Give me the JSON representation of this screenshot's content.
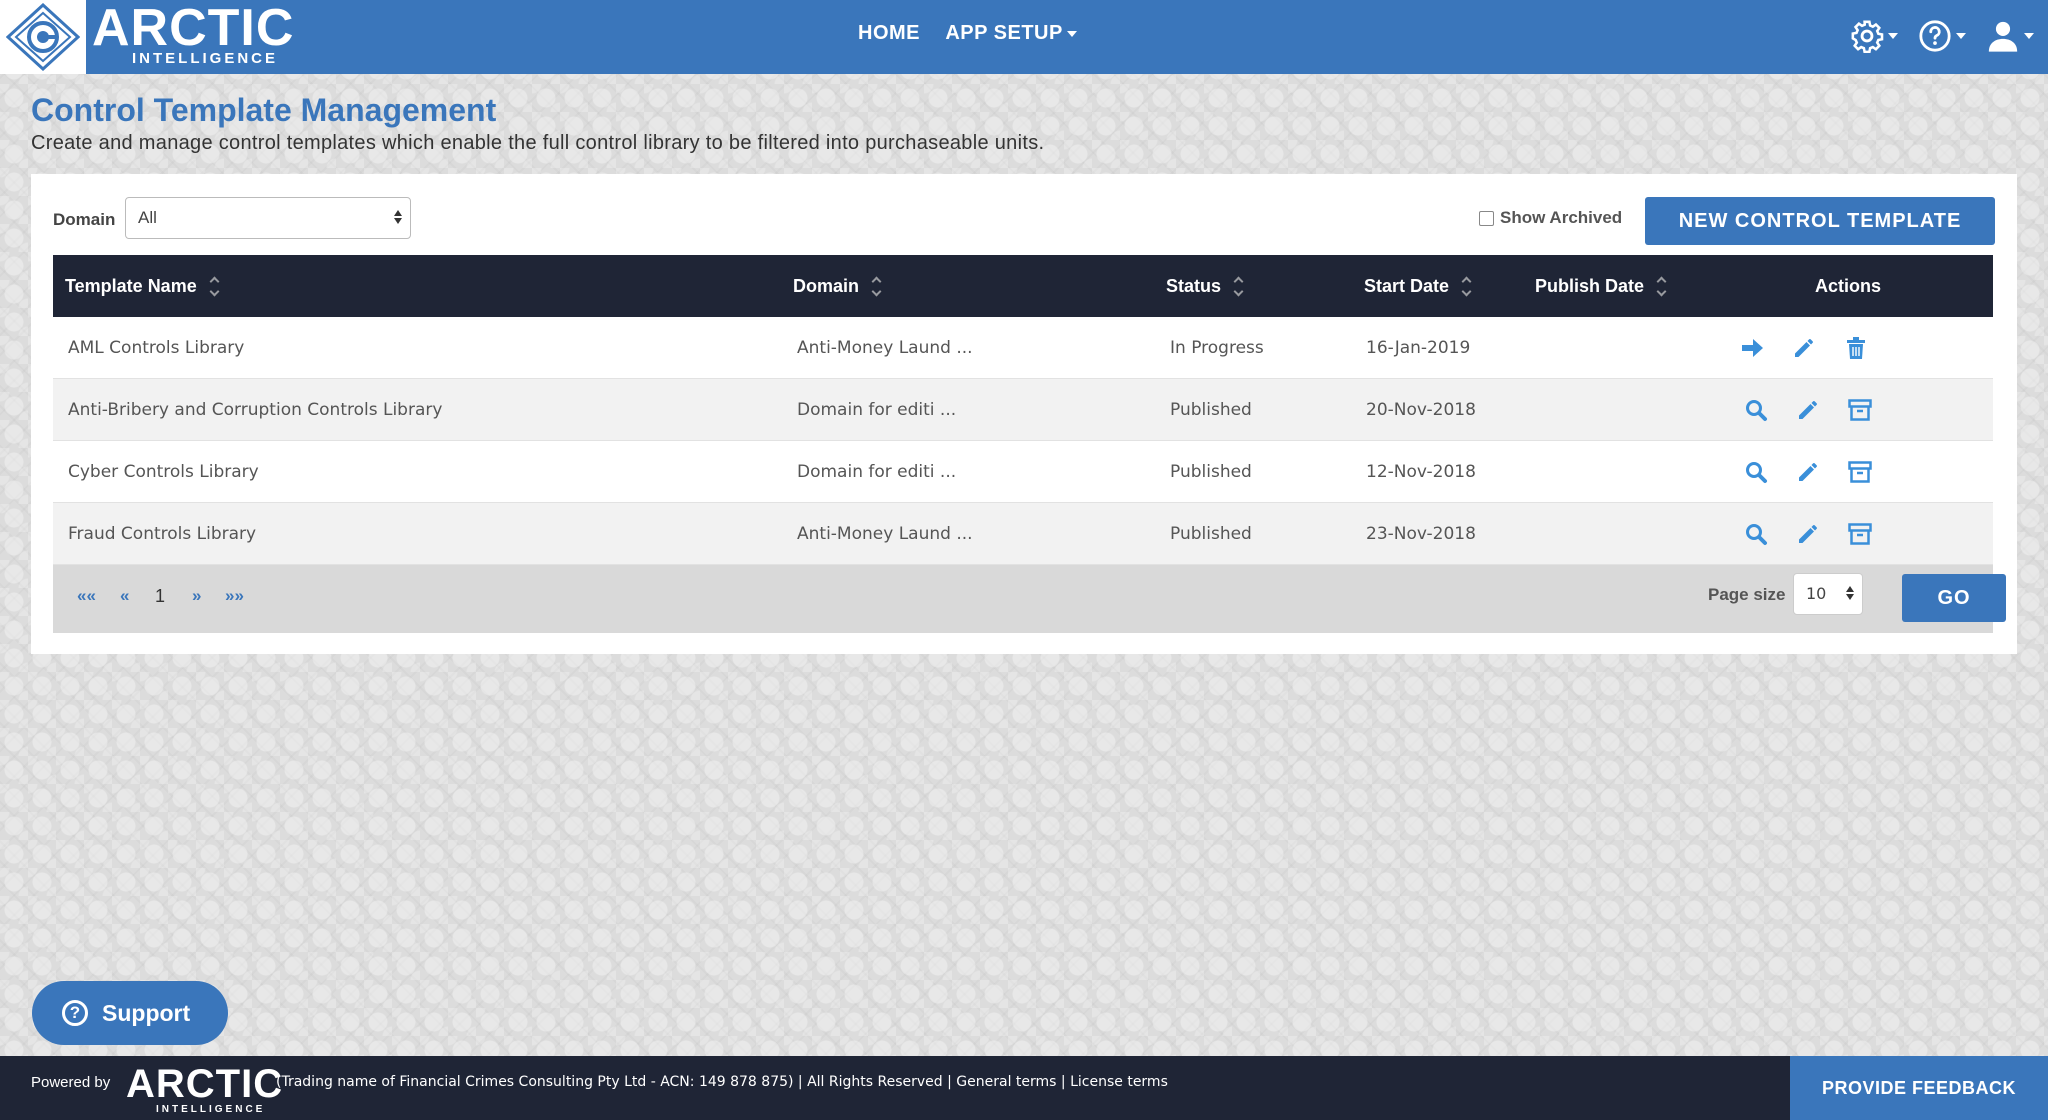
{
  "header": {
    "brand_main": "ARCTIC",
    "brand_sub": "INTELLIGENCE",
    "nav": {
      "home": "HOME",
      "app_setup": "APP SETUP"
    }
  },
  "page": {
    "title": "Control Template Management",
    "subtitle": "Create and manage control templates which enable the full control library to be filtered into purchaseable units."
  },
  "filters": {
    "domain_label": "Domain",
    "domain_value": "All",
    "show_archived": "Show Archived",
    "new_button": "NEW CONTROL TEMPLATE"
  },
  "table": {
    "columns": [
      "Template Name",
      "Domain",
      "Status",
      "Start Date",
      "Publish Date",
      "Actions"
    ],
    "rows": [
      {
        "name": "AML Controls Library",
        "domain": "Anti-Money Laund ...",
        "status": "In Progress",
        "start": "16-Jan-2019",
        "publish": ""
      },
      {
        "name": "Anti-Bribery and Corruption Controls Library",
        "domain": "Domain for editi ...",
        "status": "Published",
        "start": "20-Nov-2018",
        "publish": ""
      },
      {
        "name": "Cyber Controls Library",
        "domain": "Domain for editi ...",
        "status": "Published",
        "start": "12-Nov-2018",
        "publish": ""
      },
      {
        "name": "Fraud Controls Library",
        "domain": "Anti-Money Laund ...",
        "status": "Published",
        "start": "23-Nov-2018",
        "publish": ""
      }
    ]
  },
  "pagination": {
    "first": "««",
    "prev": "«",
    "page": "1",
    "next": "»",
    "last": "»»",
    "page_size_label": "Page size",
    "page_size": "10",
    "go": "GO"
  },
  "support": {
    "label": "Support"
  },
  "footer": {
    "powered_by": "Powered by",
    "brand_main": "ARCTIC",
    "brand_sub": "INTELLIGENCE",
    "trading": "(Trading name of Financial Crimes Consulting Pty Ltd - ACN: 149 878 875) | All Rights Reserved | ",
    "general_terms": "General terms",
    "sep": " | ",
    "license_terms": "License terms",
    "feedback": "PROVIDE FEEDBACK"
  },
  "colors": {
    "brand_blue": "#3a76bb",
    "dark_navy": "#1f2536"
  }
}
